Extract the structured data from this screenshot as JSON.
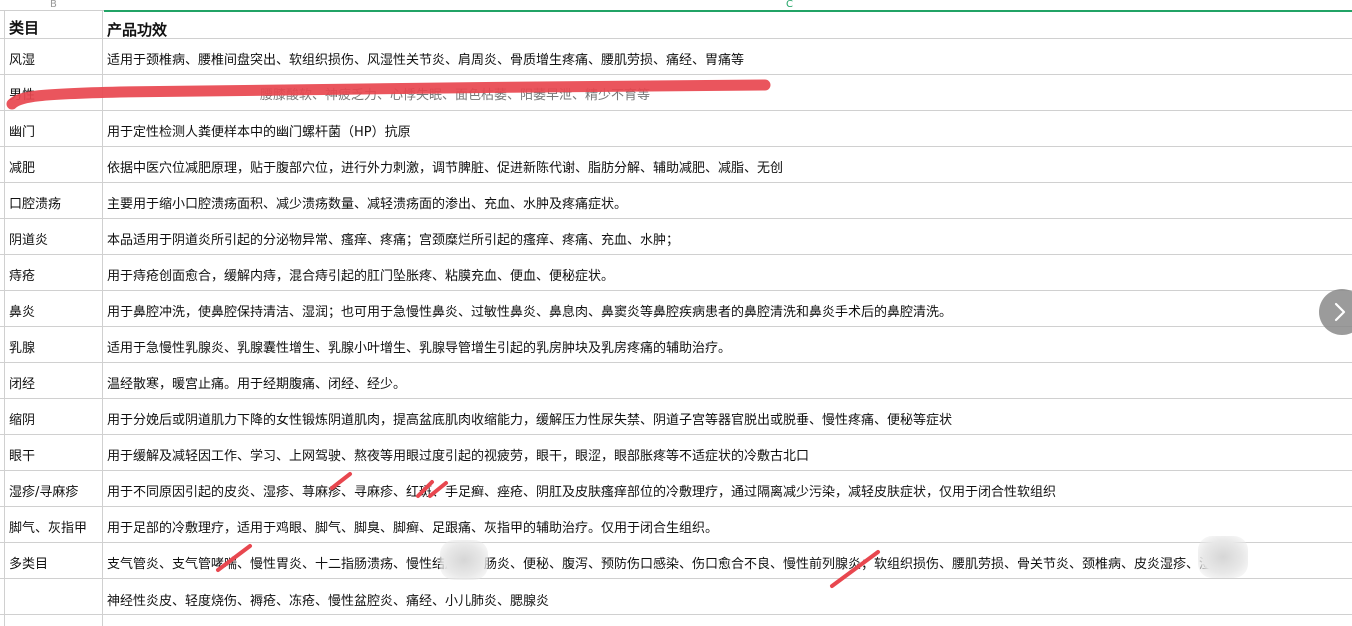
{
  "column_headers": {
    "b": "B",
    "c": "C"
  },
  "header": {
    "category": "类目",
    "effect": "产品功效"
  },
  "rows": [
    {
      "category": "风湿",
      "effect": "适用于颈椎病、腰椎间盘突出、软组织损伤、风湿性关节炎、肩周炎、骨质增生疼痛、腰肌劳损、痛经、胃痛等"
    },
    {
      "category": "男性",
      "effect": "腰膝酸软、神疲乏力、心悸失眠、面色枯萎、阳萎早泄、精少不育等"
    },
    {
      "category": "幽门",
      "effect": "用于定性检测人粪便样本中的幽门螺杆菌（HP）抗原"
    },
    {
      "category": "减肥",
      "effect": "依据中医穴位减肥原理，贴于腹部穴位，进行外力刺激，调节脾脏、促进新陈代谢、脂肪分解、辅助减肥、减脂、无创"
    },
    {
      "category": "口腔溃疡",
      "effect": "主要用于缩小口腔溃疡面积、减少溃疡数量、减轻溃疡面的渗出、充血、水肿及疼痛症状。"
    },
    {
      "category": "阴道炎",
      "effect": "本品适用于阴道炎所引起的分泌物异常、瘙痒、疼痛；宫颈糜烂所引起的瘙痒、疼痛、充血、水肿；"
    },
    {
      "category": "痔疮",
      "effect": "用于痔疮创面愈合，缓解内痔，混合痔引起的肛门坠胀疼、粘膜充血、便血、便秘症状。"
    },
    {
      "category": "鼻炎",
      "effect": "用于鼻腔冲洗，使鼻腔保持清洁、湿润；也可用于急慢性鼻炎、过敏性鼻炎、鼻息肉、鼻窦炎等鼻腔疾病患者的鼻腔清洗和鼻炎手术后的鼻腔清洗。"
    },
    {
      "category": "乳腺",
      "effect": "适用于急慢性乳腺炎、乳腺囊性增生、乳腺小叶增生、乳腺导管增生引起的乳房肿块及乳房疼痛的辅助治疗。"
    },
    {
      "category": "闭经",
      "effect": "温经散寒，暖宫止痛。用于经期腹痛、闭经、经少。"
    },
    {
      "category": "缩阴",
      "effect": "用于分娩后或阴道肌力下降的女性锻炼阴道肌肉，提高盆底肌肉收缩能力，缓解压力性尿失禁、阴道子宫等器官脱出或脱垂、慢性疼痛、便秘等症状"
    },
    {
      "category": "眼干",
      "effect": "用于缓解及减轻因工作、学习、上网驾驶、熬夜等用眼过度引起的视疲劳，眼干，眼涩，眼部胀疼等不适症状的冷敷古北口"
    },
    {
      "category": "湿疹/寻麻疹",
      "effect": "用于不同原因引起的皮炎、湿疹、荨麻疹、寻麻疹、红斑、手足癣、痤疮、阴肛及皮肤瘙痒部位的冷敷理疗，通过隔离减少污染，减轻皮肤症状，仅用于闭合性软组织"
    },
    {
      "category": "脚气、灰指甲",
      "effect": "用于足部的冷敷理疗，适用于鸡眼、脚气、脚臭、脚癣、足跟痛、灰指甲的辅助治疗。仅用于闭合生组织。"
    },
    {
      "category": "多类目",
      "effect": "支气管炎、支气管哮喘、慢性胃炎、十二指肠溃疡、慢性结肠炎、肠炎、便秘、腹泻、预防伤口感染、伤口愈合不良、慢性前列腺炎；软组织损伤、腰肌劳损、骨关节炎、颈椎病、皮炎湿疹、湿疹、"
    },
    {
      "category": "",
      "effect": "神经性炎皮、轻度烧伤、褥疮、冻疮、慢性盆腔炎、痛经、小儿肺炎、腮腺炎"
    }
  ],
  "icons": {
    "next": "chevron-right-icon"
  },
  "colors": {
    "grid": "#d0d0d0",
    "selection": "#21a366",
    "annotation": "#e8474f",
    "nav_button": "#8a8a8a"
  }
}
